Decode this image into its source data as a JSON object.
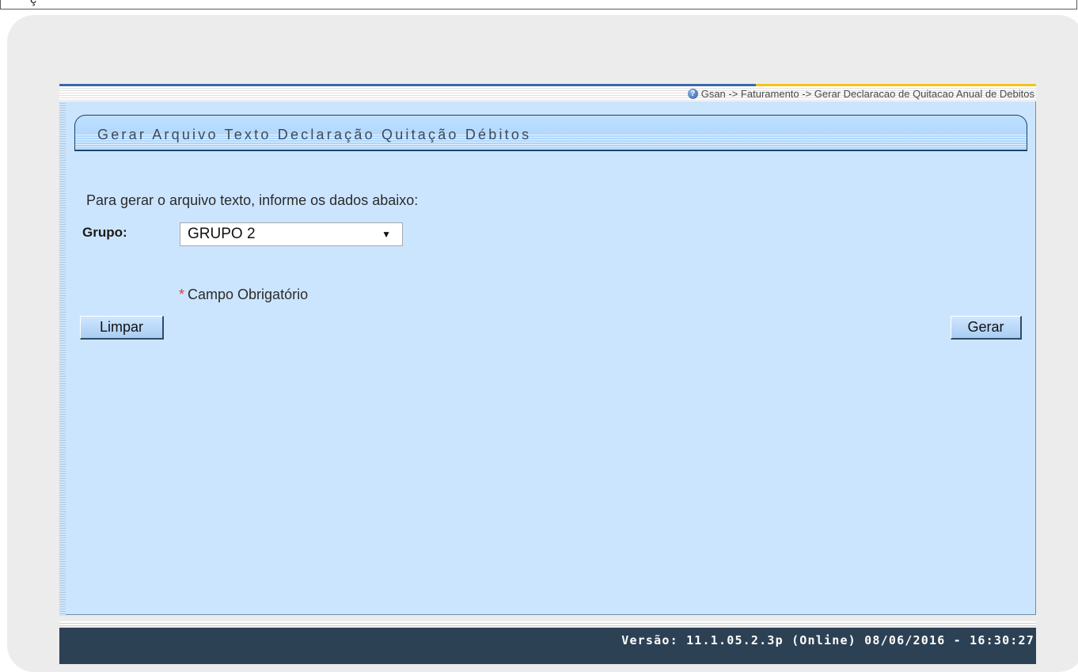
{
  "top_strip": {
    "glyph": "ç"
  },
  "breadcrumb": {
    "text": "Gsan -> Faturamento -> Gerar Declaracao de Quitacao Anual de Debitos"
  },
  "page": {
    "title": "Gerar Arquivo Texto Declaração Quitação Débitos"
  },
  "form": {
    "intro": "Para gerar o arquivo texto, informe os dados abaixo:",
    "grupo_label": "Grupo:",
    "grupo_selected": "GRUPO 2",
    "required_star": "*",
    "required_note": "Campo Obrigatório"
  },
  "buttons": {
    "limpar": "Limpar",
    "gerar": "Gerar"
  },
  "footer": {
    "version": "Versão: 11.1.05.2.3p (Online) 08/06/2016 - 16:30:27"
  },
  "icons": {
    "help": "help-icon",
    "dropdown": "chevron-down-icon"
  },
  "colors": {
    "content_bg": "#cce5ff",
    "footer_bg": "#2d4154",
    "accent_blue": "#3a6aa6",
    "accent_yellow": "#f3c419"
  }
}
